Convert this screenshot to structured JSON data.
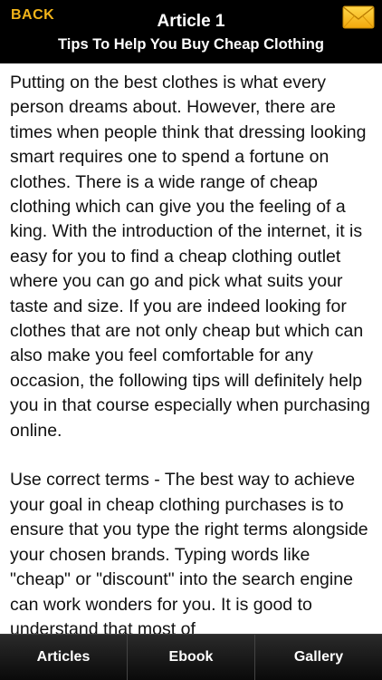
{
  "header": {
    "back_label": "BACK",
    "title": "Article 1",
    "subtitle": "Tips To Help You Buy Cheap Clothing",
    "mail_icon": "envelope-icon",
    "accent_color": "#f2b419"
  },
  "article": {
    "paragraphs": [
      "Putting on the best clothes is what every person dreams about. However, there are times when people think that dressing looking smart requires one to spend a fortune on clothes. There is a wide range of cheap clothing which can give you the feeling of a king. With the introduction of the internet, it is easy for you to find a cheap clothing outlet where you can go and pick what suits your taste and size. If you are indeed looking for clothes that are not only cheap but which can also make you feel comfortable for any occasion, the following tips will definitely help you in that course especially when purchasing online.",
      "Use correct terms - The best way to achieve your goal in cheap clothing purchases is to ensure that you type the right terms alongside your chosen brands. Typing words like \"cheap\" or \"discount\" into the search engine can work wonders for you. It is good to understand that most of"
    ]
  },
  "tabs": [
    {
      "label": "Articles"
    },
    {
      "label": "Ebook"
    },
    {
      "label": "Gallery"
    }
  ]
}
